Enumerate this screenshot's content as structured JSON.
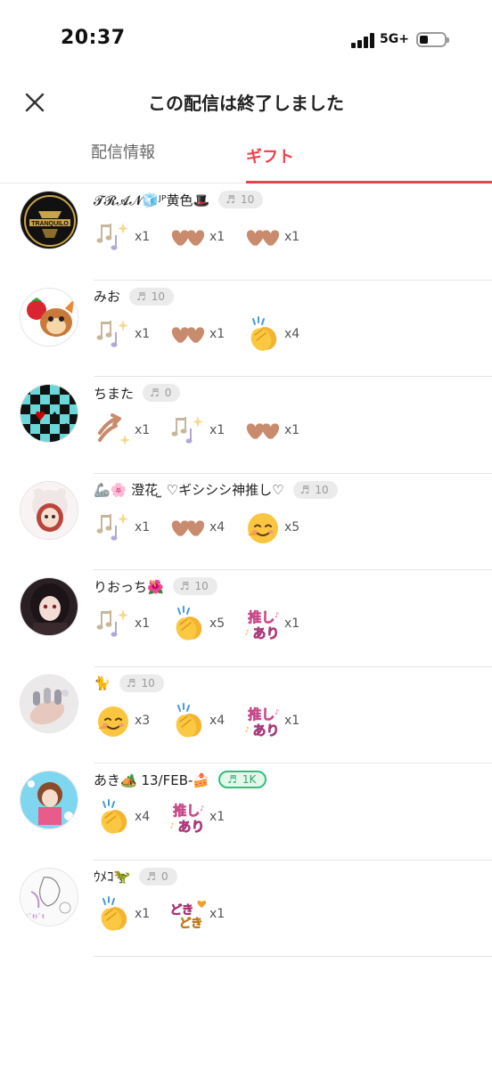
{
  "status": {
    "time": "20:37",
    "network": "5G+"
  },
  "header": {
    "title": "この配信は終了しました"
  },
  "tabs": [
    {
      "label": "配信情報",
      "selected": false
    },
    {
      "label": "ギフト",
      "selected": true
    }
  ],
  "colors": {
    "accent": "#e9424c",
    "level_badge": "#ebebeb",
    "level_badge_special": "#2fc07a"
  },
  "rows": [
    {
      "name": "𝓣𝓡𝓐𝓝🧊ᴶᴾ黄色🎩",
      "level": "10",
      "avatar": "tranquilo-logo-avatar",
      "gifts": [
        {
          "icon": "music-notes-sparkle-gift",
          "count": "x1"
        },
        {
          "icon": "hearts-gift",
          "count": "x1"
        },
        {
          "icon": "hearts-gift",
          "count": "x1"
        }
      ]
    },
    {
      "name": "みお",
      "level": "10",
      "avatar": "cartoon-cat-mouse-avatar",
      "gifts": [
        {
          "icon": "music-notes-sparkle-gift",
          "count": "x1"
        },
        {
          "icon": "hearts-gift",
          "count": "x1"
        },
        {
          "icon": "clapping-hands-gift",
          "count": "x4"
        }
      ]
    },
    {
      "name": "ちまた",
      "level": "0",
      "avatar": "checkerboard-cards-avatar",
      "gifts": [
        {
          "icon": "up-arrow-sparkle-gift",
          "count": "x1"
        },
        {
          "icon": "music-notes-sparkle-gift",
          "count": "x1"
        },
        {
          "icon": "hearts-gift",
          "count": "x1"
        }
      ]
    },
    {
      "name": "🦾🌸 澄花 ̫ ♡ギシシシ神推し♡",
      "level": "10",
      "avatar": "anime-character-avatar",
      "gifts": [
        {
          "icon": "music-notes-sparkle-gift",
          "count": "x1"
        },
        {
          "icon": "hearts-gift",
          "count": "x4"
        },
        {
          "icon": "smiling-face-gift",
          "count": "x5"
        }
      ]
    },
    {
      "name": "りおっち🌺",
      "level": "10",
      "avatar": "dark-anime-girl-avatar",
      "gifts": [
        {
          "icon": "music-notes-sparkle-gift",
          "count": "x1"
        },
        {
          "icon": "clapping-hands-gift",
          "count": "x5"
        },
        {
          "icon": "oshi-ari-text-gift",
          "count": "x1",
          "text": "推しあり"
        }
      ]
    },
    {
      "name": "🐈",
      "level": "10",
      "avatar": "nail-art-avatar",
      "gifts": [
        {
          "icon": "smiling-face-gift",
          "count": "x3"
        },
        {
          "icon": "clapping-hands-gift",
          "count": "x4"
        },
        {
          "icon": "oshi-ari-text-gift",
          "count": "x1",
          "text": "推しあり"
        }
      ]
    },
    {
      "name": "あき🏕️ 13/FEB-🍰",
      "level": "1K",
      "level_special": true,
      "avatar": "anime-collage-avatar",
      "gifts": [
        {
          "icon": "clapping-hands-gift",
          "count": "x4"
        },
        {
          "icon": "oshi-ari-text-gift",
          "count": "x1",
          "text": "推しあり"
        }
      ]
    },
    {
      "name": "ｳﾒｺ🦖",
      "level": "0",
      "avatar": "sketch-character-avatar",
      "gifts": [
        {
          "icon": "clapping-hands-gift",
          "count": "x1"
        },
        {
          "icon": "dokidoki-text-gift",
          "count": "x1",
          "text": "どきどき"
        }
      ]
    }
  ]
}
